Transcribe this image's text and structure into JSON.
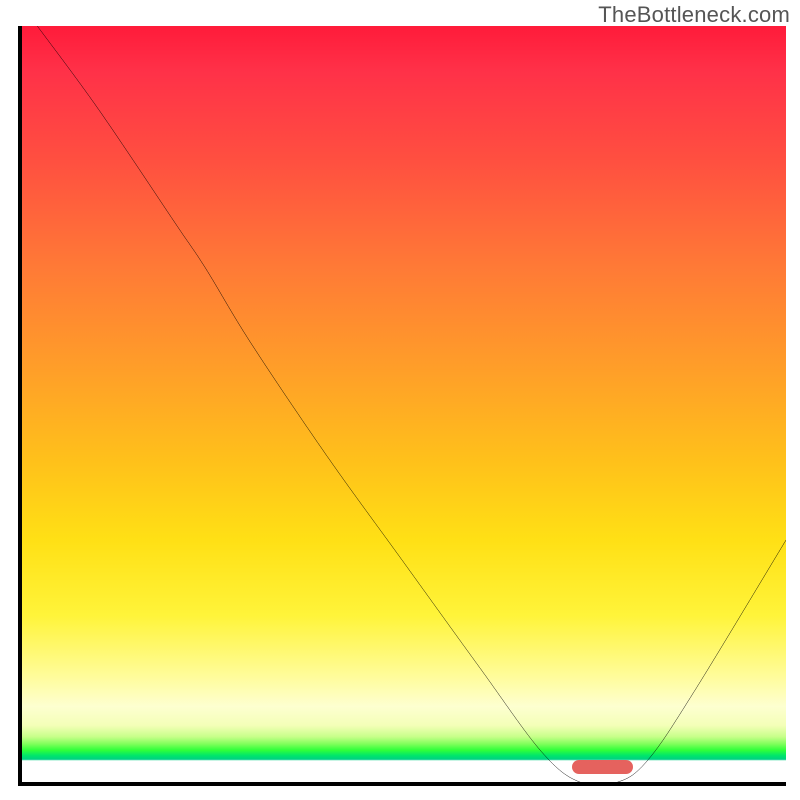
{
  "watermark": "TheBottleneck.com",
  "colors": {
    "gradient_top": "#ff1b3a",
    "gradient_mid": "#ffe015",
    "gradient_green": "#00e66a",
    "curve": "#000000",
    "marker": "#e5625e",
    "axis": "#000000",
    "watermark": "#555555"
  },
  "chart_data": {
    "type": "line",
    "title": "",
    "xlabel": "",
    "ylabel": "",
    "xlim": [
      0,
      100
    ],
    "ylim": [
      0,
      100
    ],
    "grid": false,
    "legend": false,
    "series": [
      {
        "name": "bottleneck-curve",
        "x": [
          2,
          10,
          20,
          24,
          30,
          40,
          50,
          60,
          68,
          73,
          78,
          82,
          88,
          100
        ],
        "y": [
          100,
          89,
          74,
          68,
          58,
          43,
          29,
          15,
          4,
          0,
          0,
          3,
          12,
          32
        ]
      }
    ],
    "marker": {
      "name": "optimal-range",
      "x_start": 72,
      "x_end": 80,
      "y": 0
    },
    "background_gradient": {
      "stops": [
        {
          "pos": 0,
          "color": "#ff1b3a"
        },
        {
          "pos": 46,
          "color": "#ffa028"
        },
        {
          "pos": 78,
          "color": "#fff43a"
        },
        {
          "pos": 94,
          "color": "#c8ff8a"
        },
        {
          "pos": 96.5,
          "color": "#00d084"
        },
        {
          "pos": 100,
          "color": "#ffffff"
        }
      ]
    }
  }
}
